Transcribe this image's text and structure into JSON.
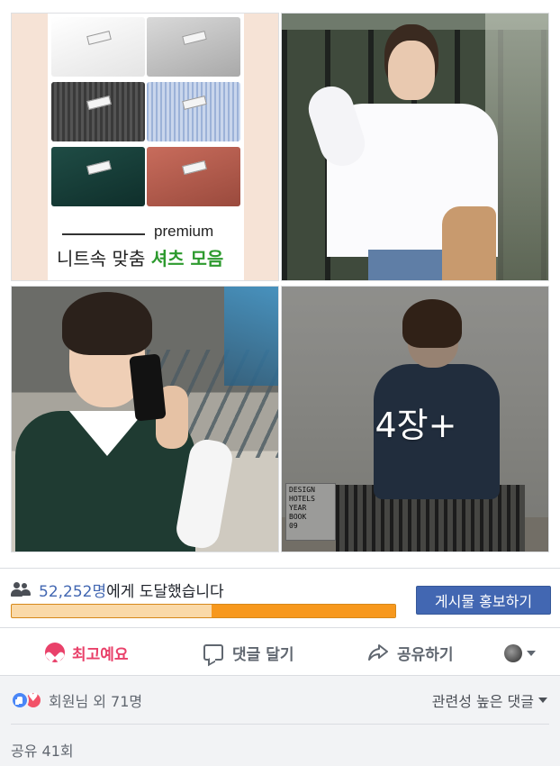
{
  "photos": {
    "tile1": {
      "caption_premium": "premium",
      "caption_title_main": "니트속 맞춤 ",
      "caption_title_accent": "셔츠 모음"
    },
    "tile4": {
      "more_overlay": "4장+",
      "book_text": "DESIGN\nHOTELS\nYEAR\nBOOK\n09"
    }
  },
  "reach": {
    "count": "52,252명",
    "text": "에게 도달했습니다",
    "progress_fraction": 0.48,
    "progress_colors": {
      "bar": "#f7981d",
      "track": "#fad9a8"
    }
  },
  "boost": {
    "label": "게시물 홍보하기",
    "color": "#4267b2"
  },
  "actions": {
    "love": "최고예요",
    "comment": "댓글 달기",
    "share": "공유하기"
  },
  "reactions": {
    "summary": "회원님 외 71명",
    "sort_label": "관련성 높은 댓글"
  },
  "shares": {
    "label": "공유 41회"
  },
  "icons": [
    "people-icon",
    "heart-icon",
    "comment-icon",
    "share-icon",
    "avatar",
    "caret-down-icon",
    "like-icon",
    "love-icon"
  ]
}
